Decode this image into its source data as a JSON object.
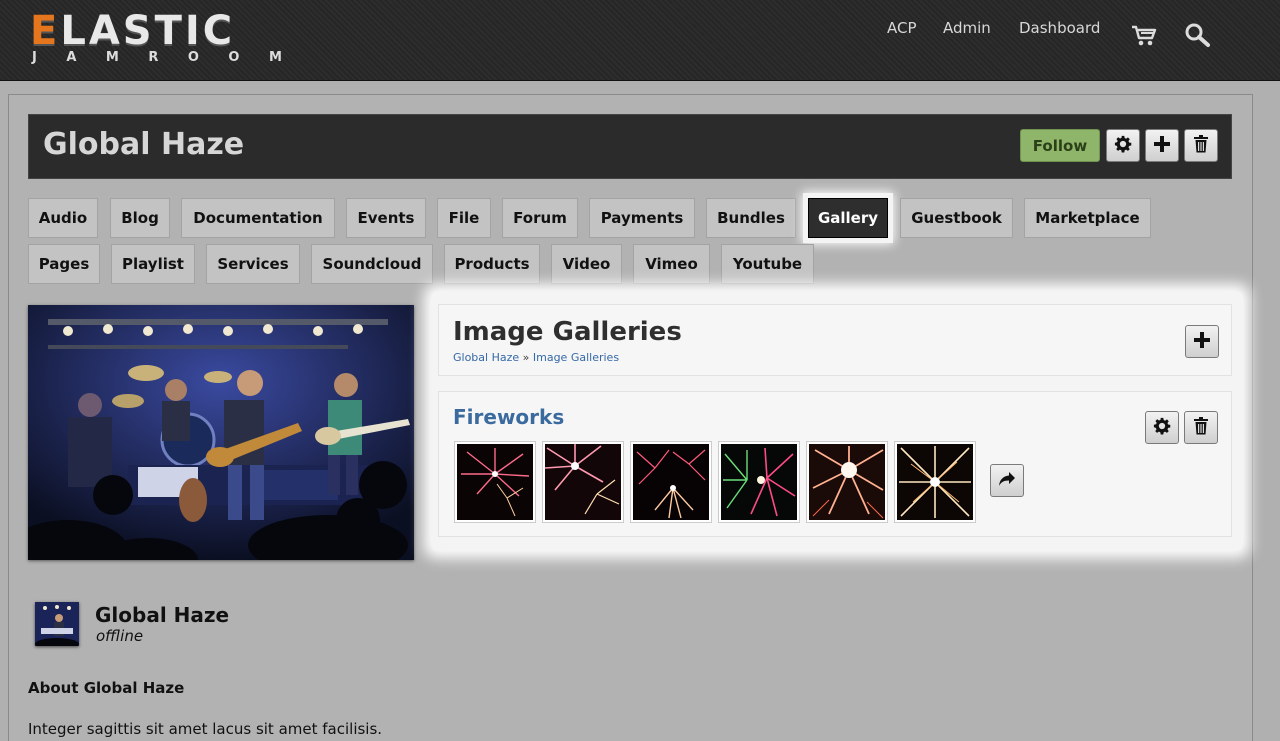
{
  "header": {
    "logo_main_e": "E",
    "logo_main_rest": "LASTIC",
    "logo_sub_letters": [
      "J",
      "A",
      "M",
      "R",
      "O",
      "O",
      "M"
    ],
    "nav": [
      "ACP",
      "Admin",
      "Dashboard"
    ],
    "icons": [
      "cart-icon",
      "search-icon"
    ]
  },
  "profile": {
    "title": "Global Haze",
    "follow_label": "Follow",
    "action_icons": [
      "gear-icon",
      "plus-icon",
      "trash-icon"
    ]
  },
  "tabs": [
    {
      "label": "Audio",
      "active": false
    },
    {
      "label": "Blog",
      "active": false
    },
    {
      "label": "Documentation",
      "active": false
    },
    {
      "label": "Events",
      "active": false
    },
    {
      "label": "File",
      "active": false
    },
    {
      "label": "Forum",
      "active": false
    },
    {
      "label": "Payments",
      "active": false
    },
    {
      "label": "Bundles",
      "active": false
    },
    {
      "label": "Gallery",
      "active": true
    },
    {
      "label": "Guestbook",
      "active": false
    },
    {
      "label": "Marketplace",
      "active": false
    },
    {
      "label": "Pages",
      "active": false
    },
    {
      "label": "Playlist",
      "active": false
    },
    {
      "label": "Services",
      "active": false
    },
    {
      "label": "Soundcloud",
      "active": false
    },
    {
      "label": "Products",
      "active": false
    },
    {
      "label": "Video",
      "active": false
    },
    {
      "label": "Vimeo",
      "active": false
    },
    {
      "label": "Youtube",
      "active": false
    }
  ],
  "galleries": {
    "title": "Image Galleries",
    "breadcrumb": {
      "first": "Global Haze",
      "separator": " » ",
      "second": "Image Galleries"
    },
    "items": [
      {
        "title": "Fireworks",
        "thumb_count_shown": 6
      }
    ]
  },
  "user": {
    "name": "Global Haze",
    "status": "offline",
    "about_title": "About Global Haze",
    "about_text": "Integer sagittis sit amet lacus sit amet facilisis."
  },
  "colors": {
    "accent_orange": "#e5761e",
    "follow_green": "#8fb56a",
    "link_blue": "#3568a8",
    "active_tab": "#2e2e2e"
  }
}
